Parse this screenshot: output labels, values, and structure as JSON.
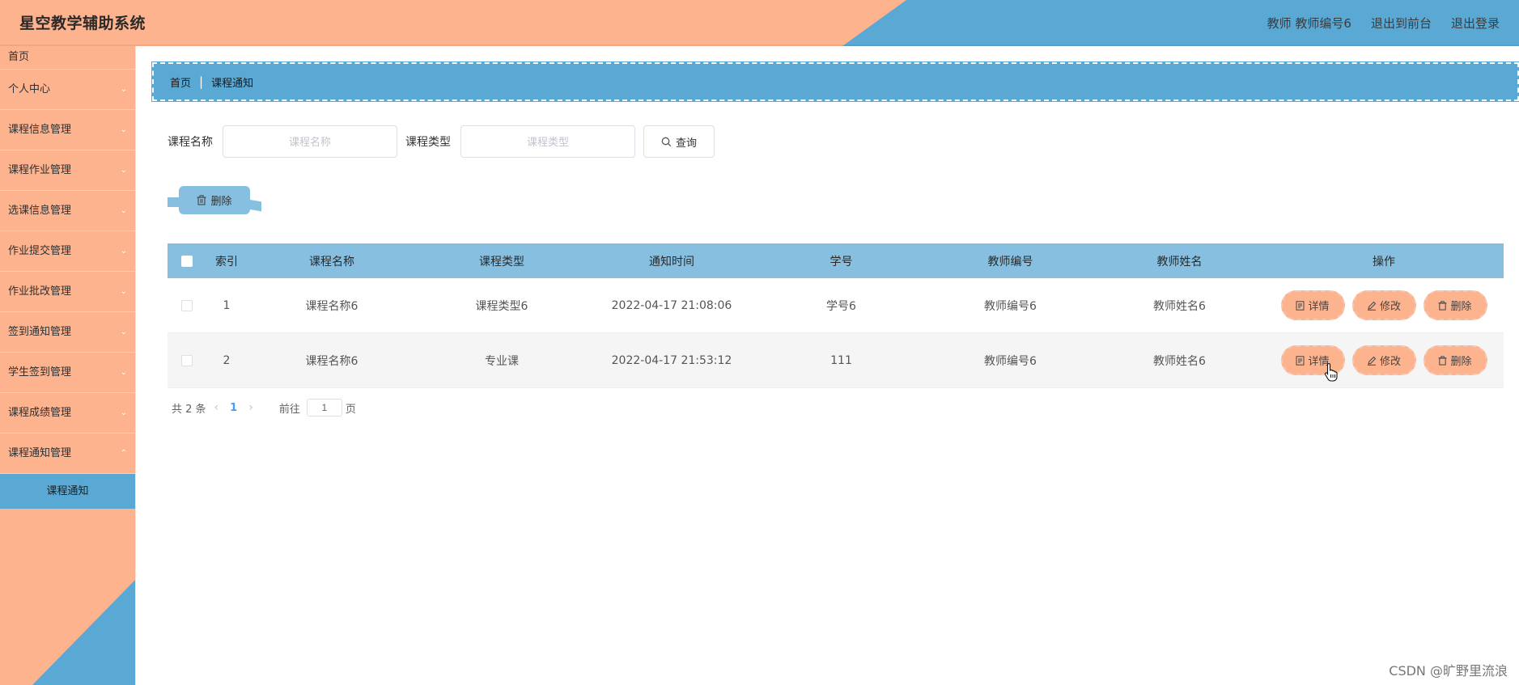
{
  "app": {
    "title": "星空教学辅助系统",
    "header_links": [
      "教师 教师编号6",
      "退出到前台",
      "退出登录"
    ]
  },
  "sidebar": {
    "items": [
      {
        "label": "首页"
      },
      {
        "label": "个人中心"
      },
      {
        "label": "课程信息管理"
      },
      {
        "label": "课程作业管理"
      },
      {
        "label": "选课信息管理"
      },
      {
        "label": "作业提交管理"
      },
      {
        "label": "作业批改管理"
      },
      {
        "label": "签到通知管理"
      },
      {
        "label": "学生签到管理"
      },
      {
        "label": "课程成绩管理"
      },
      {
        "label": "课程通知管理"
      }
    ],
    "active_sub": "课程通知"
  },
  "breadcrumb": {
    "home": "首页",
    "separator": "|",
    "current": "课程通知"
  },
  "search": {
    "name_label": "课程名称",
    "name_placeholder": "课程名称",
    "type_label": "课程类型",
    "type_placeholder": "课程类型",
    "button": "查询"
  },
  "toolbar": {
    "delete_label": "删除"
  },
  "table": {
    "headers": [
      "索引",
      "课程名称",
      "课程类型",
      "通知时间",
      "学号",
      "教师编号",
      "教师姓名",
      "操作"
    ],
    "rows": [
      {
        "index": "1",
        "course_name": "课程名称6",
        "course_type": "课程类型6",
        "time": "2022-04-17 21:08:06",
        "student_no": "学号6",
        "teacher_no": "教师编号6",
        "teacher_name": "教师姓名6"
      },
      {
        "index": "2",
        "course_name": "课程名称6",
        "course_type": "专业课",
        "time": "2022-04-17 21:53:12",
        "student_no": "111",
        "teacher_no": "教师编号6",
        "teacher_name": "教师姓名6"
      }
    ],
    "actions": {
      "detail": "详情",
      "edit": "修改",
      "delete": "删除"
    }
  },
  "pagination": {
    "total": "共 2 条",
    "current_page": "1",
    "goto_label": "前往",
    "goto_value": "1",
    "page_suffix": "页"
  },
  "watermark": "CSDN @旷野里流浪",
  "colors": {
    "peach": "#feb38f",
    "blue": "#5aa8d4",
    "light_blue": "#86bfe0"
  }
}
